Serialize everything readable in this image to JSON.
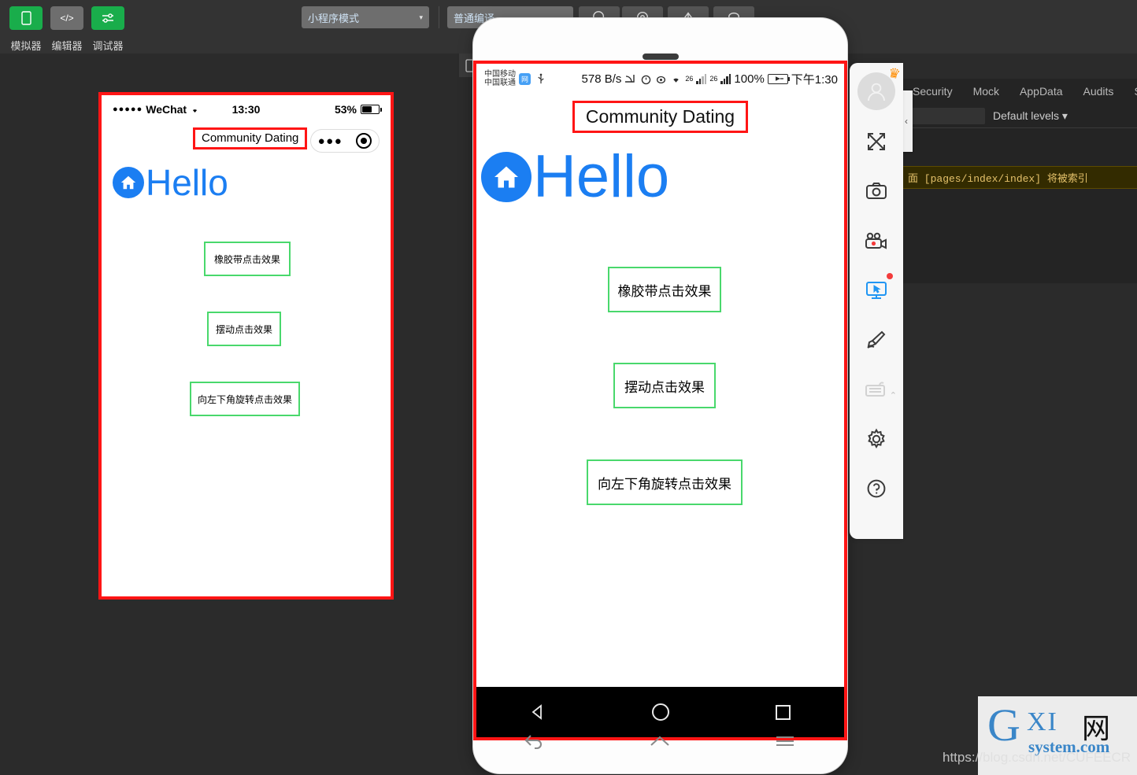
{
  "ide": {
    "toolbar_buttons": [
      {
        "label": "模拟器",
        "icon": "phone-icon",
        "state": "active"
      },
      {
        "label": "编辑器",
        "icon": "code-icon",
        "state": "inactive"
      },
      {
        "label": "调试器",
        "icon": "sliders-icon",
        "state": "active"
      }
    ],
    "mode_select": {
      "value": "小程序模式",
      "caret": "▾"
    },
    "compile_select": {
      "value": "普通编译",
      "caret": "▾"
    },
    "icon_buttons": [
      {
        "name": "preview-icon"
      },
      {
        "name": "remote-debug-icon"
      },
      {
        "name": "upload-icon"
      },
      {
        "name": "details-icon"
      }
    ]
  },
  "simulator": {
    "status_bar": {
      "signal_dots": "●●●●●",
      "carrier": "WeChat",
      "wifi": "wifi-icon",
      "time": "13:30",
      "battery_percent": "53%"
    },
    "nav_bar": {
      "title": "Community Dating",
      "capsule": {
        "more": "●●●",
        "target": "target-icon"
      }
    },
    "brand": {
      "logo": "home-icon",
      "text": "Hello",
      "color": "#1b7ef2"
    },
    "buttons": [
      {
        "label": "橡胶带点击效果"
      },
      {
        "label": "摆动点击效果"
      },
      {
        "label": "向左下角旋转点击效果"
      }
    ]
  },
  "phone": {
    "status_bar": {
      "carrier_line1": "中国移动",
      "carrier_line2": "中国联通",
      "app_badge": "网",
      "usb": "usb-icon",
      "network_speed": "578 B/s",
      "icons": [
        "cast-icon",
        "alarm-icon",
        "eye-icon",
        "wifi-icon"
      ],
      "signal_label_1": "26",
      "signal_label_2": "26",
      "battery_percent": "100%",
      "time": "下午1:30"
    },
    "nav_bar": {
      "title": "Community Dating"
    },
    "brand": {
      "logo": "home-icon",
      "text": "Hello",
      "color": "#1b7ef2"
    },
    "buttons": [
      {
        "label": "橡胶带点击效果"
      },
      {
        "label": "摆动点击效果"
      },
      {
        "label": "向左下角旋转点击效果"
      }
    ],
    "android_nav": [
      {
        "name": "back-triangle-icon"
      },
      {
        "name": "home-circle-icon"
      },
      {
        "name": "recents-square-icon"
      }
    ],
    "hardware_keys": [
      {
        "name": "back-arrow-icon"
      },
      {
        "name": "home-outline-icon"
      },
      {
        "name": "menu-lines-icon"
      }
    ]
  },
  "tool_rail": {
    "avatar": {
      "name": "user-avatar",
      "badge": "crown-badge"
    },
    "items": [
      {
        "name": "fullscreen-icon",
        "state": "normal"
      },
      {
        "name": "camera-icon",
        "state": "normal"
      },
      {
        "name": "video-record-icon",
        "state": "normal"
      },
      {
        "name": "monitor-cursor-icon",
        "state": "selected",
        "badge": "red-dot"
      },
      {
        "name": "paintbrush-icon",
        "state": "normal"
      },
      {
        "name": "keyboard-icon",
        "state": "disabled",
        "caret": "⌃"
      },
      {
        "name": "gear-icon",
        "state": "normal"
      },
      {
        "name": "help-icon",
        "state": "normal"
      }
    ]
  },
  "devtools": {
    "collapse_handle": "‹",
    "tabs": [
      "Security",
      "Mock",
      "AppData",
      "Audits",
      "Se"
    ],
    "filter_placeholder": "",
    "levels": "Default levels ▾",
    "warning": "面 [pages/index/index] 将被索引"
  },
  "watermark": {
    "logo_g": "G",
    "logo_xi": "XI",
    "logo_net": "网",
    "logo_system": "system.com",
    "url": "https://blog.csdn.net/CUFEECR"
  }
}
